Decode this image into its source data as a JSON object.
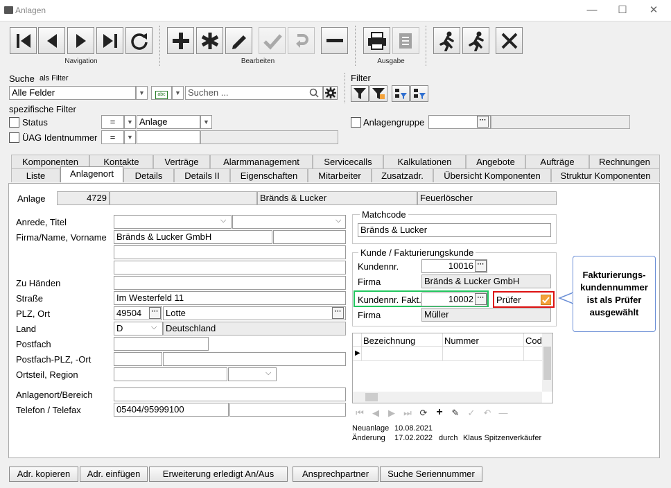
{
  "window": {
    "title": "Anlagen",
    "minimize": "—",
    "maximize": "☐",
    "close": "✕"
  },
  "toolbar": {
    "navigation_label": "Navigation",
    "bearbeiten_label": "Bearbeiten",
    "ausgabe_label": "Ausgabe"
  },
  "search": {
    "label": "Suche",
    "as_filter": "als Filter",
    "field_select": "Alle Felder",
    "placeholder": "Suchen ..."
  },
  "filter": {
    "label": "Filter"
  },
  "specific_filter": {
    "label": "spezifische Filter",
    "status_label": "Status",
    "status_op": "=",
    "status_value": "Anlage",
    "uag_label": "ÜAG Identnummer",
    "uag_op": "=",
    "anlagengruppe_label": "Anlagengruppe"
  },
  "tabs_row1": [
    "Komponenten",
    "Kontakte",
    "Verträge",
    "Alarmmanagement",
    "Servicecalls",
    "Kalkulationen",
    "Angebote",
    "Aufträge",
    "Rechnungen"
  ],
  "tabs_row2": [
    "Liste",
    "Anlagenort",
    "Details",
    "Details II",
    "Eigenschaften",
    "Mitarbeiter",
    "Zusatzadr.",
    "Übersicht Komponenten",
    "Struktur Komponenten"
  ],
  "anlage": {
    "label": "Anlage",
    "number": "4729",
    "name": "Bränds & Lucker",
    "type": "Feuerlöscher"
  },
  "address": {
    "anrede_label": "Anrede, Titel",
    "firma_label": "Firma/Name, Vorname",
    "firma_value": "Bränds & Lucker GmbH",
    "zuhanden_label": "Zu Händen",
    "strasse_label": "Straße",
    "strasse_value": "Im Westerfeld 11",
    "plz_label": "PLZ, Ort",
    "plz_value": "49504",
    "ort_value": "Lotte",
    "land_label": "Land",
    "land_code": "D",
    "land_name": "Deutschland",
    "postfach_label": "Postfach",
    "postfach_plz_label": "Postfach-PLZ, -Ort",
    "ortsteil_label": "Ortsteil, Region",
    "anlagenort_label": "Anlagenort/Bereich",
    "telefon_label": "Telefon / Telefax",
    "telefon_value": "05404/95999100"
  },
  "matchcode": {
    "title": "Matchcode",
    "value": "Bränds & Lucker"
  },
  "kunde": {
    "title": "Kunde / Fakturierungskunde",
    "kundennr_label": "Kundennr.",
    "kundennr_value": "10016",
    "firma_label": "Firma",
    "firma_value": "Bränds & Lucker GmbH",
    "fakt_label": "Kundennr. Fakt.",
    "fakt_value": "10002",
    "pruefer_label": "Prüfer",
    "firma2_label": "Firma",
    "firma2_value": "Müller"
  },
  "callout": {
    "text": "Fakturierungs-kundennummer ist als Prüfer ausgewählt"
  },
  "grid": {
    "columns": [
      "Bezeichnung",
      "Nummer",
      "Cod"
    ]
  },
  "meta": {
    "neuanlage_label": "Neuanlage",
    "neuanlage_date": "10.08.2021",
    "aenderung_label": "Änderung",
    "aenderung_date": "17.02.2022",
    "durch": "durch",
    "user": "Klaus Spitzenverkäufer"
  },
  "bottom_buttons": [
    "Adr. kopieren",
    "Adr. einfügen",
    "Erweiterung erledigt An/Aus",
    "Ansprechpartner",
    "Suche Seriennummer"
  ],
  "colors": {
    "callout_border": "#6b8fd6",
    "green_highlight": "#22c55e",
    "red_highlight": "#d11",
    "checkbox_orange": "#f3a23b"
  }
}
